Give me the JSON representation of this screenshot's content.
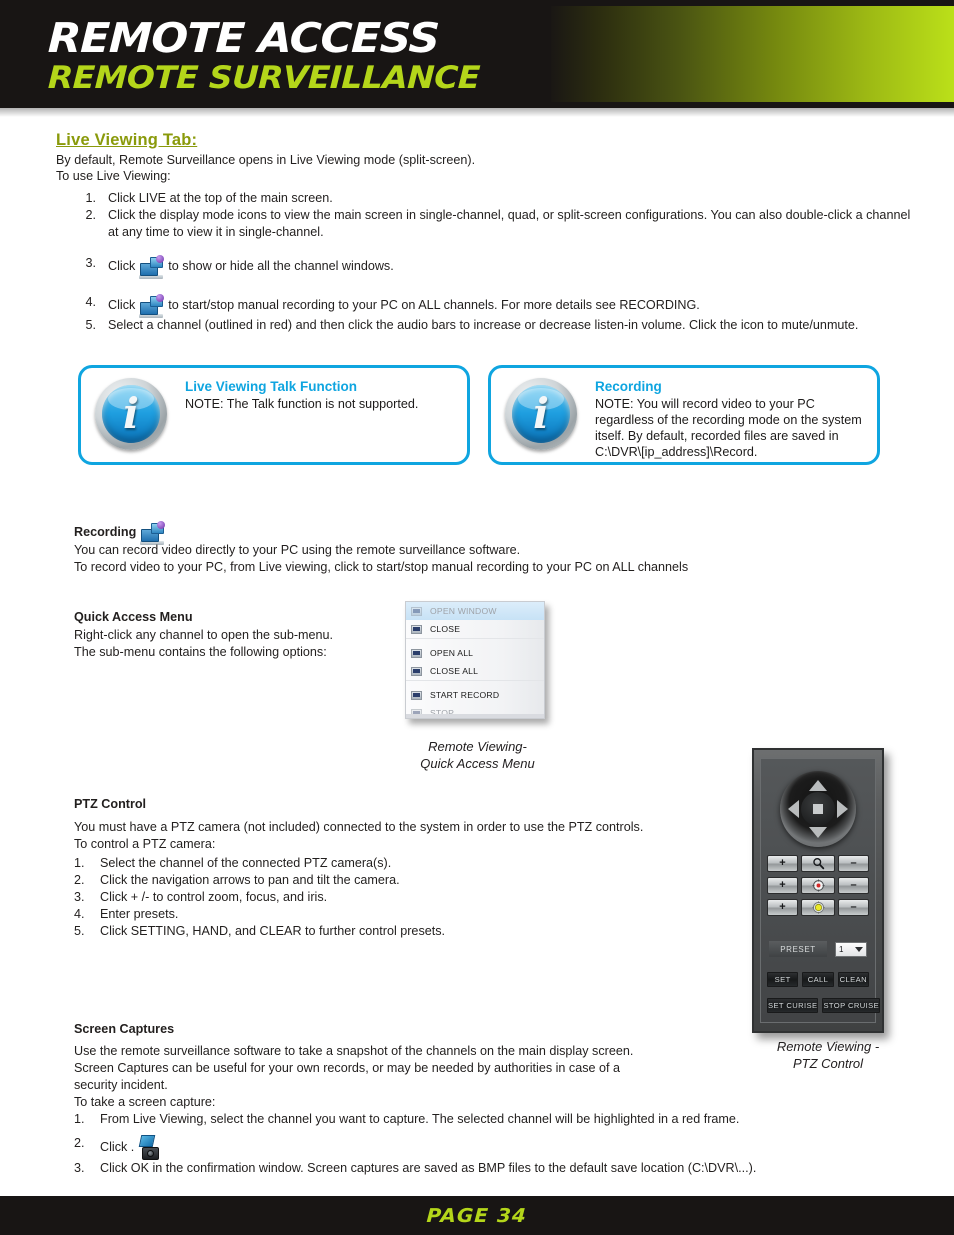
{
  "header": {
    "title": "REMOTE ACCESS",
    "subtitle": "REMOTE SURVEILLANCE",
    "accent_green": "#b4d61a",
    "dark": "#181514"
  },
  "live_viewing": {
    "heading": "Live Viewing Tab:",
    "intro_line1": "By default, Remote Surveillance opens in Live Viewing mode (split-screen).",
    "intro_line2": "To use Live Viewing:",
    "steps": [
      {
        "n": "1.",
        "text": "Click LIVE at the top of the main screen."
      },
      {
        "n": "2.",
        "text": "Click the display mode icons to view the main screen in single-channel, quad, or split-screen configurations. You can also double-click a channel at any time to view it in single-channel."
      },
      {
        "n": "3.",
        "pre": "Click",
        "post": "to show or hide all the channel windows.",
        "icon": "show-hide-channels-icon"
      },
      {
        "n": "4.",
        "pre": "Click",
        "post": "to start/stop manual recording to your PC on ALL channels. For more details see RECORDING.",
        "icon": "manual-record-icon"
      },
      {
        "n": "5.",
        "text": "Select a channel (outlined in red) and then click the audio bars to increase or decrease listen-in volume. Click the icon to mute/unmute."
      }
    ]
  },
  "info_boxes": [
    {
      "title": "Live Viewing Talk Function",
      "body": "NOTE: The Talk function is not supported.",
      "icon": "info-icon",
      "glyph": "i",
      "border_color": "#0fa5e0"
    },
    {
      "title": "Recording",
      "body": "NOTE: You will record video to your PC regardless of the recording mode on the system itself. By default, recorded files are saved in C:\\DVR\\[ip_address]\\Record.",
      "icon": "info-icon",
      "glyph": "i",
      "border_color": "#0fa5e0"
    }
  ],
  "recording": {
    "heading": "Recording",
    "icon": "manual-record-icon",
    "line1": "You can record video directly to your PC using the remote surveillance software.",
    "line2": "To record video to your PC, from Live viewing, click to start/stop manual recording to your PC on ALL channels"
  },
  "quick_access": {
    "heading": "Quick Access Menu",
    "line1": "Right-click any channel to open the sub-menu.",
    "line2": "The sub-menu contains the following options:",
    "menu_items": [
      {
        "label": "OPEN WINDOW",
        "state": "highlighted-disabled"
      },
      {
        "label": "CLOSE",
        "state": "normal"
      },
      {
        "label": "OPEN ALL",
        "state": "normal"
      },
      {
        "label": "CLOSE ALL",
        "state": "normal"
      },
      {
        "label": "START RECORD",
        "state": "normal"
      },
      {
        "label": "STOP",
        "state": "disabled"
      }
    ],
    "caption_line1": "Remote Viewing-",
    "caption_line2": "Quick Access Menu"
  },
  "ptz": {
    "heading": "PTZ Control",
    "line1": "You must have a PTZ camera (not included) connected to the system in order to use the PTZ controls.",
    "line2": "To control a PTZ camera:",
    "steps": [
      {
        "n": "1.",
        "text": "Select the channel of the connected PTZ camera(s)."
      },
      {
        "n": "2.",
        "text": "Click the navigation arrows to pan and tilt the camera."
      },
      {
        "n": "3.",
        "text": "Click + /- to control zoom, focus, and iris."
      },
      {
        "n": "4.",
        "text": "Enter presets."
      },
      {
        "n": "5.",
        "text": "Click SETTING, HAND, and CLEAR to further control presets."
      }
    ],
    "panel": {
      "dpad_icons": [
        "arrow-up-icon",
        "arrow-left-icon",
        "arrow-right-icon",
        "arrow-down-icon",
        "stop-center-icon"
      ],
      "rows": [
        {
          "plus": "+",
          "icon": "zoom-magnifier-icon",
          "minus": "–"
        },
        {
          "plus": "+",
          "icon": "focus-target-icon",
          "minus": "–"
        },
        {
          "plus": "+",
          "icon": "iris-lamp-icon",
          "minus": "–"
        }
      ],
      "preset_label": "PRESET",
      "preset_value": "1",
      "buttons_row1": [
        "SET",
        "CALL",
        "CLEAN"
      ],
      "buttons_row2": [
        "SET CURISE",
        "STOP CRUISE"
      ]
    },
    "caption_line1": "Remote Viewing -",
    "caption_line2": "PTZ Control"
  },
  "screen_captures": {
    "heading": "Screen Captures",
    "para_line1": "Use the remote surveillance software to take a snapshot of the channels on the main display screen.",
    "para_line2": "Screen Captures can be useful for your own records, or may be needed by authorities in case of a",
    "para_line3": "security incident.",
    "para_line4": "To take a screen capture:",
    "steps": [
      {
        "n": "1.",
        "text": "From Live Viewing, select the channel you want to capture. The selected channel will be highlighted in a red frame."
      },
      {
        "n": "2.",
        "pre": "Click .",
        "icon": "snapshot-camera-icon"
      },
      {
        "n": "3.",
        "text": "Click OK in the confirmation window. Screen captures are saved as BMP files to the default save location (C:\\DVR\\...)."
      }
    ]
  },
  "footer": {
    "page_label": "PAGE 34"
  }
}
